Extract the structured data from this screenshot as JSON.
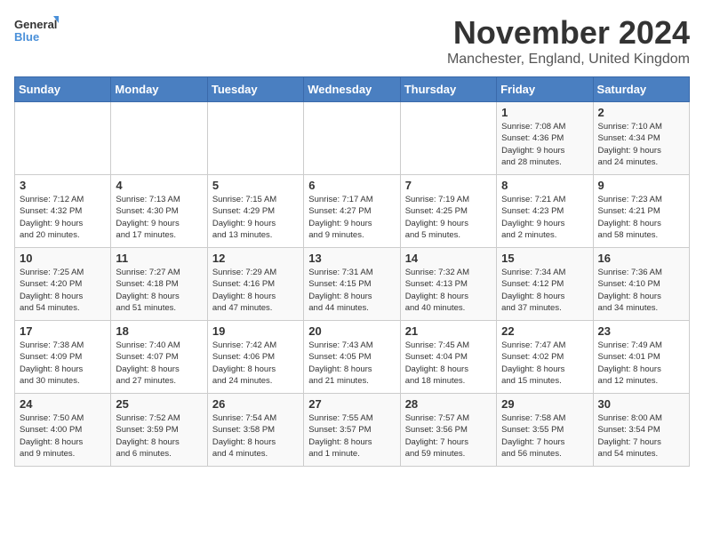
{
  "logo": {
    "line1": "General",
    "line2": "Blue"
  },
  "title": "November 2024",
  "subtitle": "Manchester, England, United Kingdom",
  "days_of_week": [
    "Sunday",
    "Monday",
    "Tuesday",
    "Wednesday",
    "Thursday",
    "Friday",
    "Saturday"
  ],
  "weeks": [
    [
      {
        "day": "",
        "info": ""
      },
      {
        "day": "",
        "info": ""
      },
      {
        "day": "",
        "info": ""
      },
      {
        "day": "",
        "info": ""
      },
      {
        "day": "",
        "info": ""
      },
      {
        "day": "1",
        "info": "Sunrise: 7:08 AM\nSunset: 4:36 PM\nDaylight: 9 hours\nand 28 minutes."
      },
      {
        "day": "2",
        "info": "Sunrise: 7:10 AM\nSunset: 4:34 PM\nDaylight: 9 hours\nand 24 minutes."
      }
    ],
    [
      {
        "day": "3",
        "info": "Sunrise: 7:12 AM\nSunset: 4:32 PM\nDaylight: 9 hours\nand 20 minutes."
      },
      {
        "day": "4",
        "info": "Sunrise: 7:13 AM\nSunset: 4:30 PM\nDaylight: 9 hours\nand 17 minutes."
      },
      {
        "day": "5",
        "info": "Sunrise: 7:15 AM\nSunset: 4:29 PM\nDaylight: 9 hours\nand 13 minutes."
      },
      {
        "day": "6",
        "info": "Sunrise: 7:17 AM\nSunset: 4:27 PM\nDaylight: 9 hours\nand 9 minutes."
      },
      {
        "day": "7",
        "info": "Sunrise: 7:19 AM\nSunset: 4:25 PM\nDaylight: 9 hours\nand 5 minutes."
      },
      {
        "day": "8",
        "info": "Sunrise: 7:21 AM\nSunset: 4:23 PM\nDaylight: 9 hours\nand 2 minutes."
      },
      {
        "day": "9",
        "info": "Sunrise: 7:23 AM\nSunset: 4:21 PM\nDaylight: 8 hours\nand 58 minutes."
      }
    ],
    [
      {
        "day": "10",
        "info": "Sunrise: 7:25 AM\nSunset: 4:20 PM\nDaylight: 8 hours\nand 54 minutes."
      },
      {
        "day": "11",
        "info": "Sunrise: 7:27 AM\nSunset: 4:18 PM\nDaylight: 8 hours\nand 51 minutes."
      },
      {
        "day": "12",
        "info": "Sunrise: 7:29 AM\nSunset: 4:16 PM\nDaylight: 8 hours\nand 47 minutes."
      },
      {
        "day": "13",
        "info": "Sunrise: 7:31 AM\nSunset: 4:15 PM\nDaylight: 8 hours\nand 44 minutes."
      },
      {
        "day": "14",
        "info": "Sunrise: 7:32 AM\nSunset: 4:13 PM\nDaylight: 8 hours\nand 40 minutes."
      },
      {
        "day": "15",
        "info": "Sunrise: 7:34 AM\nSunset: 4:12 PM\nDaylight: 8 hours\nand 37 minutes."
      },
      {
        "day": "16",
        "info": "Sunrise: 7:36 AM\nSunset: 4:10 PM\nDaylight: 8 hours\nand 34 minutes."
      }
    ],
    [
      {
        "day": "17",
        "info": "Sunrise: 7:38 AM\nSunset: 4:09 PM\nDaylight: 8 hours\nand 30 minutes."
      },
      {
        "day": "18",
        "info": "Sunrise: 7:40 AM\nSunset: 4:07 PM\nDaylight: 8 hours\nand 27 minutes."
      },
      {
        "day": "19",
        "info": "Sunrise: 7:42 AM\nSunset: 4:06 PM\nDaylight: 8 hours\nand 24 minutes."
      },
      {
        "day": "20",
        "info": "Sunrise: 7:43 AM\nSunset: 4:05 PM\nDaylight: 8 hours\nand 21 minutes."
      },
      {
        "day": "21",
        "info": "Sunrise: 7:45 AM\nSunset: 4:04 PM\nDaylight: 8 hours\nand 18 minutes."
      },
      {
        "day": "22",
        "info": "Sunrise: 7:47 AM\nSunset: 4:02 PM\nDaylight: 8 hours\nand 15 minutes."
      },
      {
        "day": "23",
        "info": "Sunrise: 7:49 AM\nSunset: 4:01 PM\nDaylight: 8 hours\nand 12 minutes."
      }
    ],
    [
      {
        "day": "24",
        "info": "Sunrise: 7:50 AM\nSunset: 4:00 PM\nDaylight: 8 hours\nand 9 minutes."
      },
      {
        "day": "25",
        "info": "Sunrise: 7:52 AM\nSunset: 3:59 PM\nDaylight: 8 hours\nand 6 minutes."
      },
      {
        "day": "26",
        "info": "Sunrise: 7:54 AM\nSunset: 3:58 PM\nDaylight: 8 hours\nand 4 minutes."
      },
      {
        "day": "27",
        "info": "Sunrise: 7:55 AM\nSunset: 3:57 PM\nDaylight: 8 hours\nand 1 minute."
      },
      {
        "day": "28",
        "info": "Sunrise: 7:57 AM\nSunset: 3:56 PM\nDaylight: 7 hours\nand 59 minutes."
      },
      {
        "day": "29",
        "info": "Sunrise: 7:58 AM\nSunset: 3:55 PM\nDaylight: 7 hours\nand 56 minutes."
      },
      {
        "day": "30",
        "info": "Sunrise: 8:00 AM\nSunset: 3:54 PM\nDaylight: 7 hours\nand 54 minutes."
      }
    ]
  ]
}
